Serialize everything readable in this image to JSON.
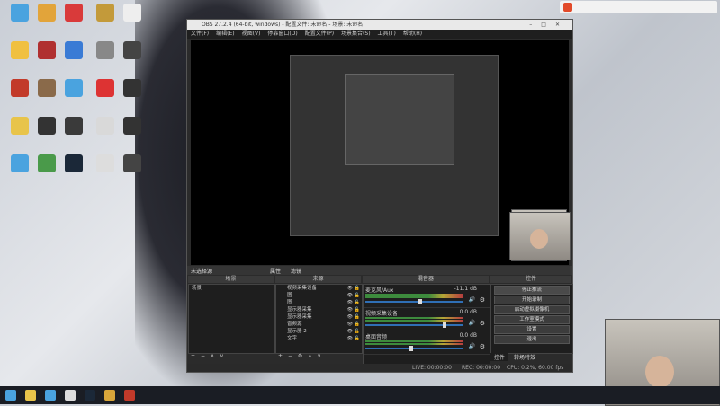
{
  "desktop_icons": [
    {
      "label": "",
      "color": "#4aa3df"
    },
    {
      "label": "",
      "color": "#e2a43a"
    },
    {
      "label": "",
      "color": "#d93a3a"
    },
    {
      "label": "",
      "color": "#c39a3a"
    },
    {
      "label": "",
      "color": "#eeeeee"
    },
    {
      "label": "",
      "color": "#f0c040"
    },
    {
      "label": "",
      "color": "#b03030"
    },
    {
      "label": "",
      "color": "#3a7bd5"
    },
    {
      "label": "",
      "color": "#888888"
    },
    {
      "label": "",
      "color": "#444444"
    },
    {
      "label": "",
      "color": "#c23a2a"
    },
    {
      "label": "",
      "color": "#8a6a4a"
    },
    {
      "label": "",
      "color": "#4aa3df"
    },
    {
      "label": "",
      "color": "#d33"
    },
    {
      "label": "",
      "color": "#333"
    },
    {
      "label": "",
      "color": "#e8c44a"
    },
    {
      "label": "",
      "color": "#333"
    },
    {
      "label": "",
      "color": "#3a3a3a"
    },
    {
      "label": "",
      "color": "#d9d9d9"
    },
    {
      "label": "",
      "color": "#333"
    },
    {
      "label": "",
      "color": "#4aa3df"
    },
    {
      "label": "",
      "color": "#4a9a4a"
    },
    {
      "label": "",
      "color": "#1b2838"
    },
    {
      "label": "",
      "color": "#ddd"
    },
    {
      "label": "",
      "color": "#444"
    }
  ],
  "obs": {
    "title": "OBS 27.2.4 (64-bit, windows) - 配置文件: 未命名 - 场景: 未命名",
    "menu": [
      "文件(F)",
      "编辑(E)",
      "视图(V)",
      "停靠窗口(D)",
      "配置文件(P)",
      "场景集合(S)",
      "工具(T)",
      "帮助(H)"
    ],
    "bar_label": "未选择源",
    "bar_buttons": [
      "属性",
      "滤镜"
    ],
    "panels": {
      "scenes": "场景",
      "sources": "来源",
      "mixer": "混音器",
      "controls": "控件"
    },
    "scene_list": [
      "场景"
    ],
    "source_list": [
      "视频采集设备",
      "图",
      "图",
      "显示器采集",
      "显示器采集",
      "音频源",
      "显示器 2",
      "文字"
    ],
    "mixer": [
      {
        "name": "麦克风/Aux",
        "db": "-11.1 dB",
        "level": 0.55
      },
      {
        "name": "视频采集设备",
        "db": "0.0 dB",
        "level": 0.8
      },
      {
        "name": "桌面音频",
        "db": "0.0 dB",
        "level": 0.45
      }
    ],
    "controls": [
      "停止推流",
      "开始录制",
      "启动虚拟摄像机",
      "工作室模式",
      "设置",
      "退出"
    ],
    "bottom_buttons": [
      "控件",
      "转场特效"
    ],
    "status": {
      "live": "LIVE: 00:00:00",
      "rec": "REC: 00:00:00",
      "cpu": "CPU: 0.2%, 60.00 fps"
    }
  },
  "taskbar": {
    "icons": [
      {
        "name": "windows-start-icon",
        "color": "#4aa3df"
      },
      {
        "name": "file-explorer-icon",
        "color": "#e8c44a"
      },
      {
        "name": "browser-icon",
        "color": "#4aa3df"
      },
      {
        "name": "obs-icon",
        "color": "#dddddd"
      },
      {
        "name": "steam-icon",
        "color": "#1b2838"
      },
      {
        "name": "app-icon",
        "color": "#d9a63a"
      },
      {
        "name": "record-icon",
        "color": "#c23a2a"
      }
    ]
  }
}
